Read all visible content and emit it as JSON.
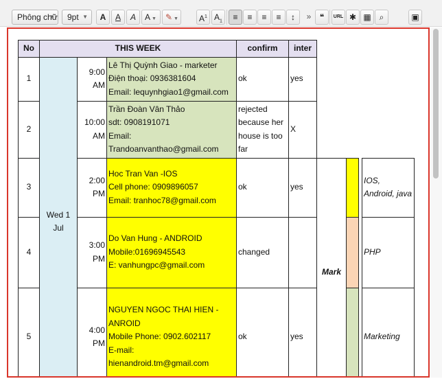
{
  "toolbar": {
    "font_family": "Phông chữ",
    "font_size": "9pt",
    "buttons": [
      {
        "label": "A",
        "icon": "font-color-icon"
      },
      {
        "label": "A",
        "icon": "underline-icon"
      },
      {
        "label": "A",
        "icon": "italic-icon"
      },
      {
        "label": "A",
        "icon": "text-color-icon"
      },
      {
        "label": "✎",
        "icon": "highlight-icon"
      },
      {
        "label": "A",
        "icon": "superscript-icon"
      },
      {
        "label": "A",
        "icon": "subscript-icon"
      },
      {
        "label": "≡",
        "icon": "align-left-icon"
      },
      {
        "label": "≡",
        "icon": "align-center-icon"
      },
      {
        "label": "≡",
        "icon": "align-right-icon"
      },
      {
        "label": "≡",
        "icon": "justify-icon"
      },
      {
        "label": "↕",
        "icon": "line-height-icon"
      },
      {
        "label": "»",
        "icon": "more-icon"
      },
      {
        "label": "❝",
        "icon": "quote-icon"
      },
      {
        "label": "URL",
        "icon": "url-icon"
      },
      {
        "label": "✱",
        "icon": "special-char-icon"
      },
      {
        "label": "▦",
        "icon": "table-icon"
      },
      {
        "label": "⌕",
        "icon": "search-icon"
      },
      {
        "label": "▣",
        "icon": "media-icon"
      }
    ]
  },
  "table": {
    "headers": {
      "no": "No",
      "this_week": "THIS WEEK",
      "confirm": "confirm",
      "inter": "inter"
    },
    "day": "Wed 1 Jul",
    "mark": "Mark",
    "rows": [
      {
        "no": "1",
        "time": "9:00 AM",
        "details": [
          "Lê Thị Quỳnh Giao - marketer",
          "Điện thoại: 0936381604",
          "Email: lequynhgiao1@gmail.com"
        ],
        "confirm": "ok",
        "inter": "yes",
        "skill": ""
      },
      {
        "no": "2",
        "time": "10:00 AM",
        "details": [
          "Trần Đoàn Vân Thảo",
          "sdt: 0908191071",
          "Email:",
          "Trandoanvanthao@gmail.com"
        ],
        "confirm": "rejected because her house is too far",
        "inter": "X",
        "skill": ""
      },
      {
        "no": "3",
        "time": "2:00 PM",
        "details": [
          "Hoc Tran Van -IOS",
          "Cell phone: 0909896057",
          "Email: tranhoc78@gmail.com"
        ],
        "confirm": "ok",
        "inter": "yes",
        "skill": "IOS, Android, java"
      },
      {
        "no": "4",
        "time": "3:00 PM",
        "details": [
          "Do Van Hung - ANDROID",
          "Mobile:01696945543",
          "E: vanhungpc@gmail.com"
        ],
        "confirm": "changed",
        "inter": "",
        "skill": "PHP"
      },
      {
        "no": "5",
        "time": "4:00 PM",
        "details": [
          "NGUYEN NGOC THAI HIEN - ANROID",
          "Mobile Phone: 0902.602117",
          "E-mail:",
          "hienandroid.tm@gmail.com"
        ],
        "confirm": "ok",
        "inter": "yes",
        "skill": "Marketing"
      }
    ]
  },
  "colors": {
    "accent_border": "#d9352a",
    "header_bg": "#e4dff0",
    "green": "#d7e4bd",
    "yellow": "#ffff00",
    "blue": "#dbeef4",
    "peach": "#fbd5b5"
  }
}
